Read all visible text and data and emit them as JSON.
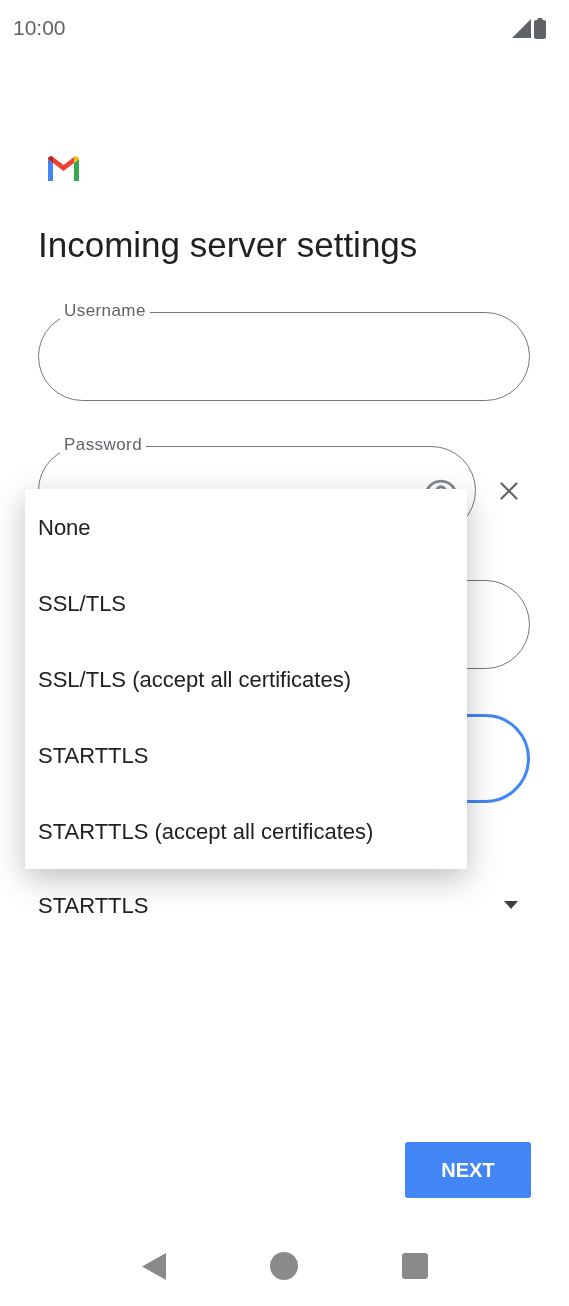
{
  "status_bar": {
    "time": "10:00"
  },
  "title": "Incoming server settings",
  "fields": [
    {
      "label": "Username",
      "kind": "text",
      "focused": false
    },
    {
      "label": "Password",
      "kind": "password",
      "focused": false
    },
    {
      "kind": "text",
      "focused": false
    },
    {
      "kind": "text",
      "focused": true
    }
  ],
  "security_dropdown": {
    "value": "STARTTLS"
  },
  "menu": {
    "items": [
      "None",
      "SSL/TLS",
      "SSL/TLS (accept all certificates)",
      "STARTTLS",
      "STARTTLS (accept all certificates)"
    ]
  },
  "next_button": "NEXT"
}
